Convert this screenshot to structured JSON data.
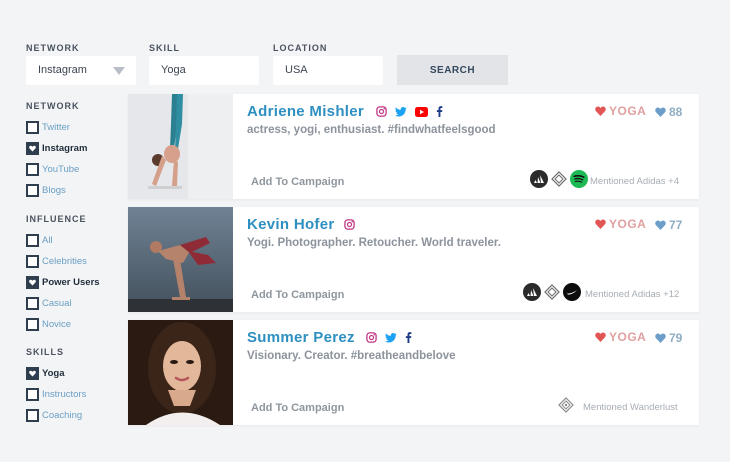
{
  "filters": {
    "network_label": "NETWORK",
    "network_value": "Instagram",
    "skill_label": "SKILL",
    "skill_value": "Yoga",
    "location_label": "LOCATION",
    "location_value": "USA",
    "search_label": "SEARCH"
  },
  "sidebar": {
    "network": {
      "label": "NETWORK",
      "options": [
        {
          "label": "Twitter",
          "checked": false
        },
        {
          "label": "Instagram",
          "checked": true
        },
        {
          "label": "YouTube",
          "checked": false
        },
        {
          "label": "Blogs",
          "checked": false
        }
      ]
    },
    "influence": {
      "label": "INFLUENCE",
      "options": [
        {
          "label": "All",
          "checked": false
        },
        {
          "label": "Celebrities",
          "checked": false
        },
        {
          "label": "Power Users",
          "checked": true
        },
        {
          "label": "Casual",
          "checked": false
        },
        {
          "label": "Novice",
          "checked": false
        }
      ]
    },
    "skills": {
      "label": "SKILLS",
      "options": [
        {
          "label": "Yoga",
          "checked": true
        },
        {
          "label": "Instructors",
          "checked": false
        },
        {
          "label": "Coaching",
          "checked": false
        }
      ]
    }
  },
  "results": [
    {
      "name": "Adriene Mishler",
      "bio": "actress, yogi, enthusiast. #findwhatfeelsgood",
      "skill": "YOGA",
      "score": "88",
      "add_label": "Add To Campaign",
      "mentioned": "Mentioned Adidas +4",
      "socials": [
        "instagram-icon",
        "twitter-icon",
        "youtube-icon",
        "facebook-icon"
      ],
      "brands": [
        "adidas-logo-icon",
        "brand-diamond-icon",
        "spotify-icon"
      ]
    },
    {
      "name": "Kevin Hofer",
      "bio": "Yogi. Photographer. Retoucher. World traveler.",
      "skill": "YOGA",
      "score": "77",
      "add_label": "Add To Campaign",
      "mentioned": "Mentioned Adidas +12",
      "socials": [
        "instagram-icon"
      ],
      "brands": [
        "adidas-logo-icon",
        "brand-diamond-icon",
        "nike-logo-icon"
      ]
    },
    {
      "name": "Summer Perez",
      "bio": "Visionary. Creator. #breatheandbelove",
      "skill": "YOGA",
      "score": "79",
      "add_label": "Add To Campaign",
      "mentioned": "Mentioned Wanderlust",
      "socials": [
        "instagram-icon",
        "twitter-icon",
        "facebook-icon"
      ],
      "brands": [
        "wanderlust-logo-icon"
      ]
    }
  ],
  "colors": {
    "accent": "#2e8fc1",
    "navy": "#2f3e4f",
    "skill": "#e1a0a0",
    "score": "#8faec4",
    "instagram": "#c13584",
    "twitter": "#1da1f2",
    "youtube": "#ff0000",
    "facebook": "#1f3c88",
    "spotify": "#1db954"
  }
}
